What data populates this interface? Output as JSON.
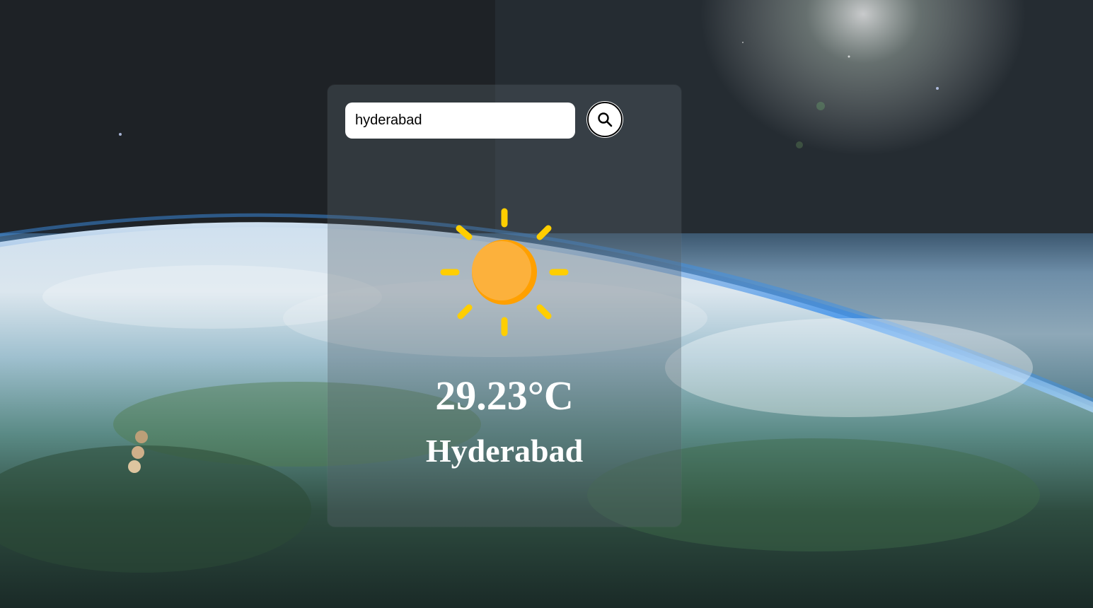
{
  "search": {
    "value": "hyderabad",
    "icon": "search-icon"
  },
  "weather": {
    "icon": "sun-icon",
    "temperature": "29.23°C",
    "city": "Hyderabad"
  },
  "colors": {
    "sun_body": "#FCB13C",
    "sun_rays": "#FFCE00"
  }
}
